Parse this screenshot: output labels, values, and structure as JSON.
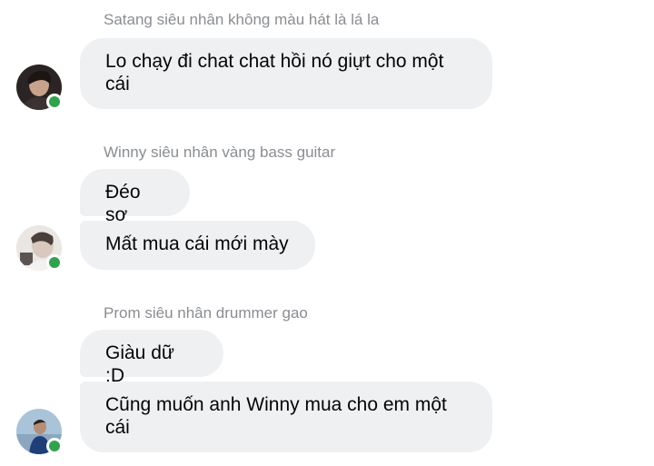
{
  "groups": [
    {
      "sender": "Satang siêu nhân không màu hát là lá la",
      "messages": [
        "Lo chạy đi chat chat hồi nó giựt cho một cái"
      ]
    },
    {
      "sender": "Winny siêu nhân vàng bass guitar",
      "messages": [
        "Đéo sợ",
        "Mất mua cái mới mày"
      ]
    },
    {
      "sender": "Prom siêu nhân drummer gao",
      "messages": [
        "Giàu dữ :D",
        "Cũng muốn anh Winny mua cho em một cái"
      ]
    }
  ],
  "colors": {
    "bubble": "#eff0f2",
    "sender": "#8a8d91",
    "online": "#31a24c"
  }
}
